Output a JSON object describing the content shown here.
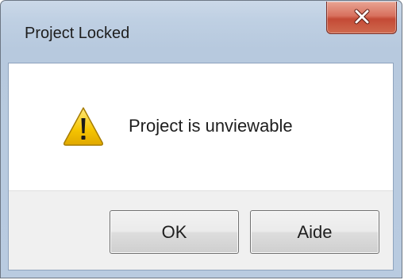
{
  "dialog": {
    "title": "Project Locked",
    "message": "Project is unviewable",
    "icon": "warning-icon",
    "buttons": {
      "ok_label": "OK",
      "help_label": "Aide"
    }
  },
  "titlebar": {
    "close_icon": "close-icon",
    "close_color": "#c44a35"
  },
  "colors": {
    "frame": "#bfd0e3",
    "warning_yellow": "#f5c400",
    "button_face": "#e5e5e5"
  }
}
